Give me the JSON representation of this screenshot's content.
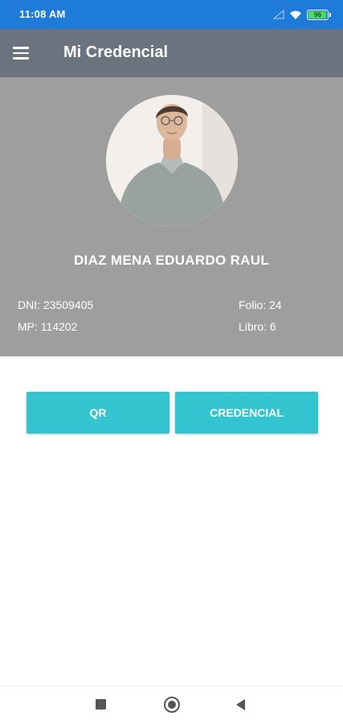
{
  "status_bar": {
    "time": "11:08 AM",
    "battery": "96",
    "battery_level": 0.96,
    "icons": [
      "signal-icon",
      "wifi-icon",
      "battery-icon"
    ]
  },
  "app_bar": {
    "title": "Mi Credencial",
    "menu_icon": "hamburger-menu-icon"
  },
  "profile": {
    "name": "DIAZ MENA EDUARDO RAUL",
    "dni": "DNI: 23509405",
    "mp": "MP: 114202",
    "folio": "Folio: 24",
    "libro": "Libro: 6"
  },
  "actions": {
    "qr_label": "QR",
    "credencial_label": "CREDENCIAL"
  },
  "colors": {
    "status_bar": "#1e7bd8",
    "app_bar": "#6b747e",
    "profile_bg": "#9e9e9e",
    "accent": "#33c4cf"
  },
  "nav_bar": {
    "icons": [
      "recents-icon",
      "home-icon",
      "back-icon"
    ]
  }
}
